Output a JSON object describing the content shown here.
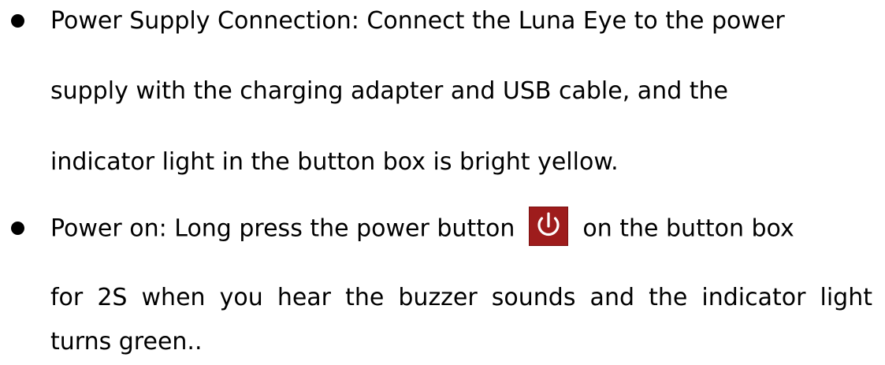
{
  "bullets": [
    {
      "lines": [
        "Power Supply Connection: Connect the Luna Eye to the power",
        "supply with the charging adapter and USB cable, and the",
        "indicator light in the button box is bright yellow."
      ]
    },
    {
      "line1_before_icon": "Power on: Long press the power button",
      "line1_after_icon": "on the button box",
      "line2": "for 2S when you hear the buzzer sounds and the indicator light",
      "line3": "turns green.."
    }
  ],
  "icon": {
    "name": "power-icon",
    "background_color": "#9e1c1c",
    "symbol_color": "#ffffff"
  }
}
